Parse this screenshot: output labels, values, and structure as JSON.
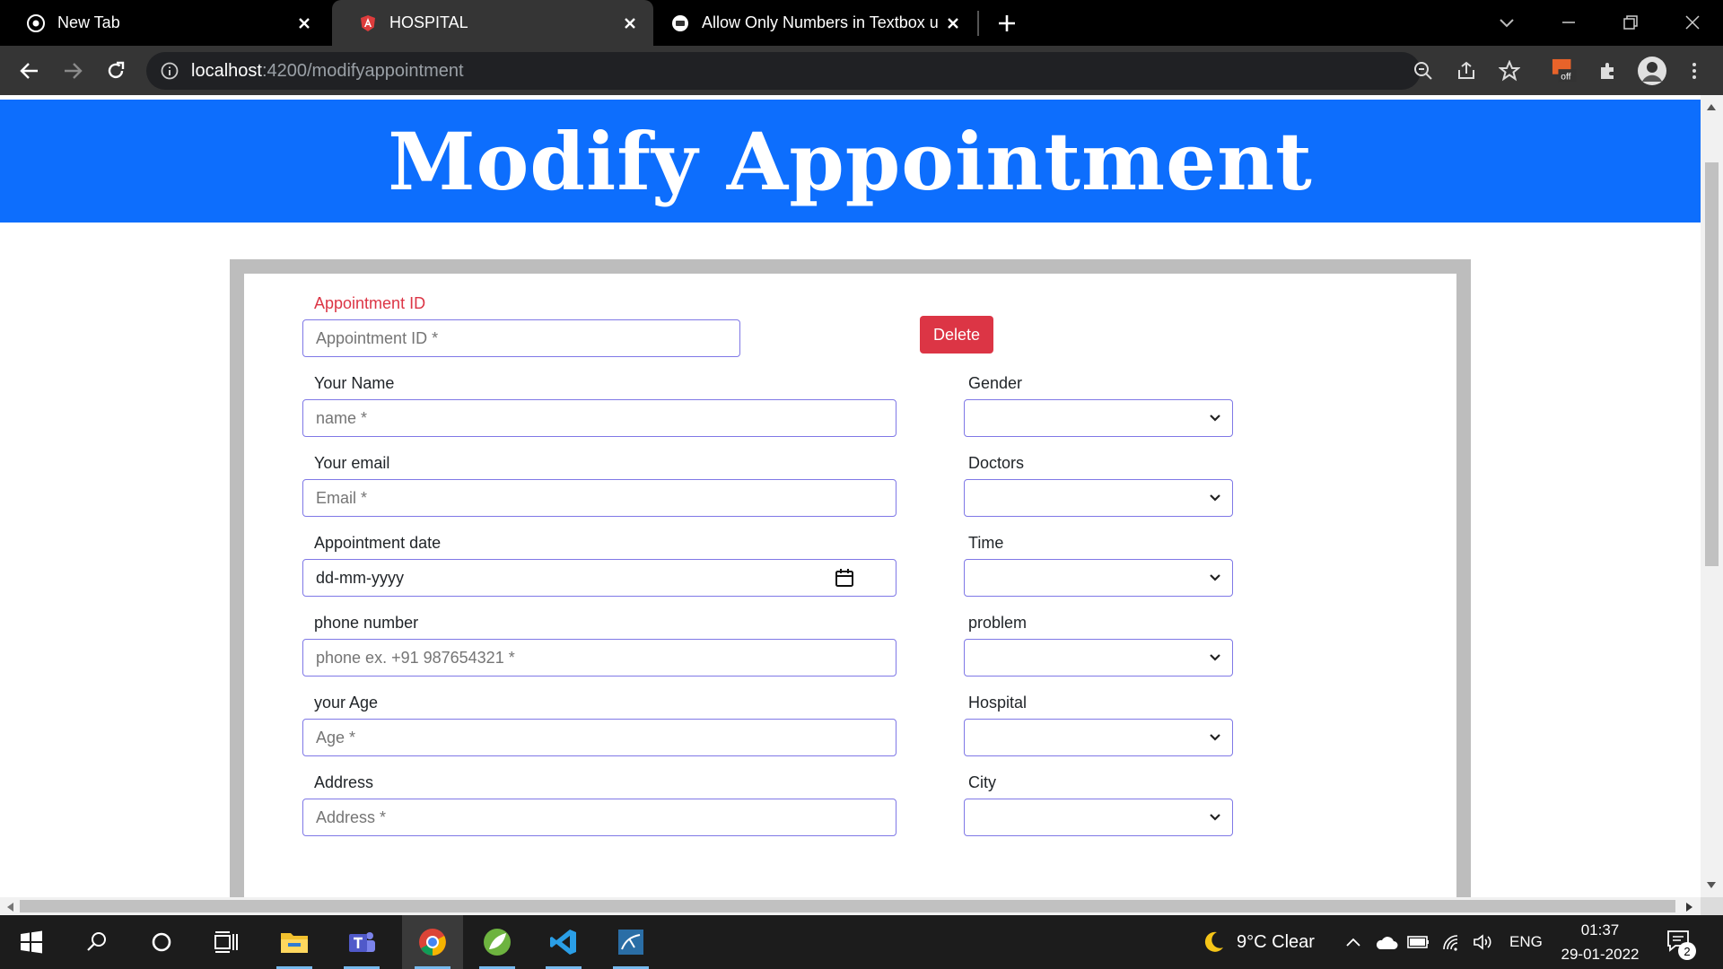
{
  "browser": {
    "tabs": [
      {
        "title": "New Tab",
        "favicon": "chrome-icon"
      },
      {
        "title": "HOSPITAL",
        "favicon": "angular-icon"
      },
      {
        "title": "Allow Only Numbers in Textbox u",
        "favicon": "site-icon"
      }
    ],
    "url_host": "localhost",
    "url_path": ":4200/modifyappointment"
  },
  "page": {
    "heading": "Modify Appointment",
    "colors": {
      "banner": "#0d6efd",
      "delete": "#dc3545",
      "input_border": "#7f78e6"
    },
    "appointment_id": {
      "label": "Appointment ID",
      "placeholder": "Appointment ID *"
    },
    "delete_label": "Delete",
    "left_fields": [
      {
        "label": "Your Name",
        "placeholder": "name *"
      },
      {
        "label": "Your email",
        "placeholder": "Email *"
      },
      {
        "label": "Appointment date",
        "value": "dd-mm-yyyy"
      },
      {
        "label": "phone number",
        "placeholder": "phone ex. +91 987654321 *"
      },
      {
        "label": "your Age",
        "placeholder": "Age *"
      },
      {
        "label": "Address",
        "placeholder": "Address *"
      }
    ],
    "right_fields": [
      {
        "label": "Gender"
      },
      {
        "label": "Doctors"
      },
      {
        "label": "Time"
      },
      {
        "label": "problem"
      },
      {
        "label": "Hospital"
      },
      {
        "label": "City"
      }
    ]
  },
  "taskbar": {
    "weather": "9°C  Clear",
    "lang": "ENG",
    "time": "01:37",
    "date": "29-01-2022",
    "notifications": "2"
  }
}
